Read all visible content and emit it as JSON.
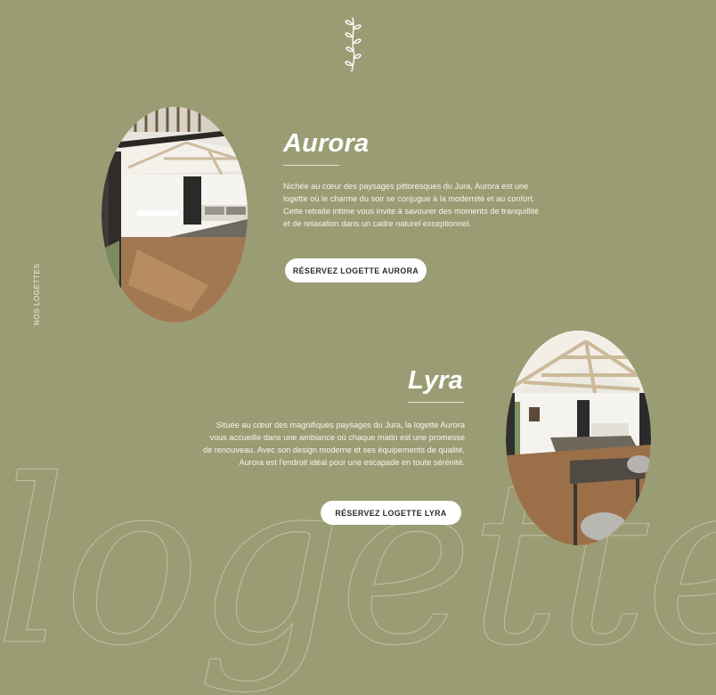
{
  "section": {
    "vertical_label": "NOS LOGETTES",
    "background_word": "logettes",
    "ornament_icon": "sprig-icon"
  },
  "logettes": [
    {
      "title": "Aurora",
      "description": "Nichée au cœur des paysages pittoresques du Jura, Aurora est une logette où le charme du soir se conjugue à la modernité et au confort. Cette retraite intime vous invite à savourer des moments de tranquillité et de relaxation dans un cadre naturel exceptionnel.",
      "button_label": "RÉSERVEZ LOGETTE AURORA"
    },
    {
      "title": "Lyra",
      "description": "Située au cœur des magnifiques paysages du Jura, la logette Aurora vous accueille dans une ambiance où chaque matin est une promesse de renouveau. Avec son design moderne et ses équipements de qualité, Aurora est l'endroit idéal pour une escapade en toute sérénité.",
      "button_label": "RÉSERVEZ LOGETTE LYRA"
    }
  ],
  "colors": {
    "background": "#9a9c73",
    "button_bg": "#ffffff",
    "button_text": "#2b2b22",
    "text": "#ffffff"
  }
}
